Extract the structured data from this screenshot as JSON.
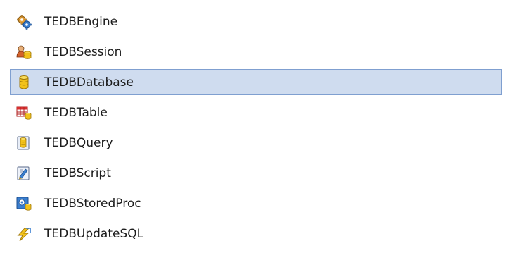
{
  "component_list": {
    "items": [
      {
        "label": "TEDBEngine",
        "icon": "gears-icon",
        "selected": false
      },
      {
        "label": "TEDBSession",
        "icon": "users-database-icon",
        "selected": false
      },
      {
        "label": "TEDBDatabase",
        "icon": "database-icon",
        "selected": true
      },
      {
        "label": "TEDBTable",
        "icon": "table-icon",
        "selected": false
      },
      {
        "label": "TEDBQuery",
        "icon": "query-icon",
        "selected": false
      },
      {
        "label": "TEDBScript",
        "icon": "script-icon",
        "selected": false
      },
      {
        "label": "TEDBStoredProc",
        "icon": "stored-proc-icon",
        "selected": false
      },
      {
        "label": "TEDBUpdateSQL",
        "icon": "update-sql-icon",
        "selected": false
      }
    ]
  },
  "colors": {
    "selection_background": "#cfdcef",
    "selection_border": "#7f9fd0",
    "database_yellow": "#f2c21a",
    "icon_blue": "#2f6fc0"
  }
}
